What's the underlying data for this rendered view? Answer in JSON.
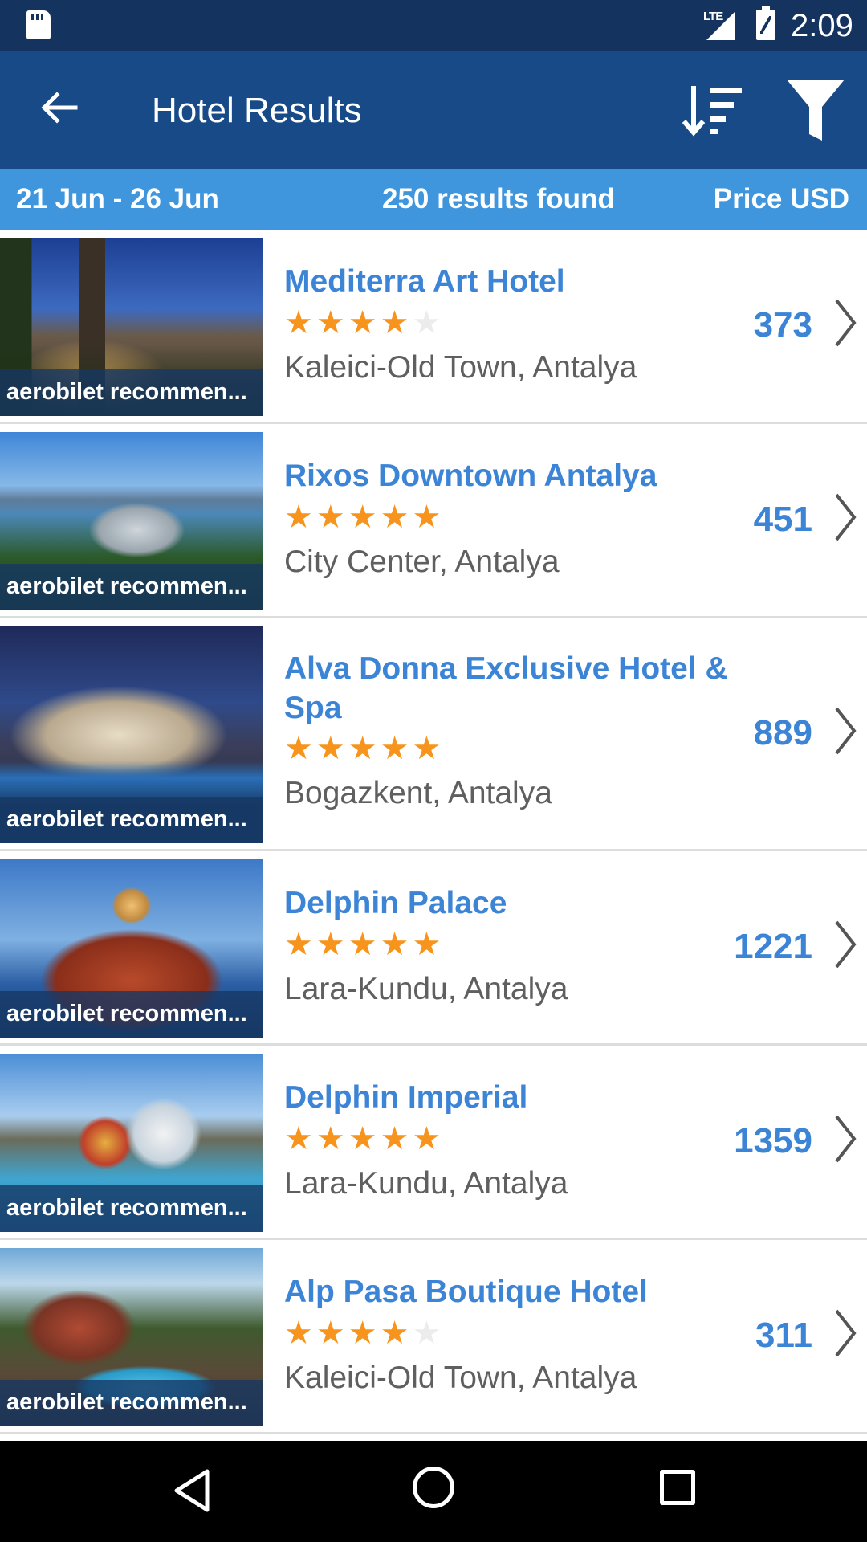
{
  "status_bar": {
    "network_label": "LTE",
    "time": "2:09",
    "icons": [
      "sd-card-icon",
      "signal-icon",
      "battery-icon"
    ]
  },
  "app_bar": {
    "title": "Hotel Results",
    "icons": [
      "back-arrow-icon",
      "sort-icon",
      "filter-icon"
    ],
    "background": "#174a87"
  },
  "summary": {
    "dates": "21 Jun - 26 Jun",
    "results": "250 results found",
    "currency": "Price USD",
    "background": "#3f96dd"
  },
  "colors": {
    "accent": "#3c84d6",
    "star": "#f7941d",
    "location_text": "#5f5f5f"
  },
  "hotels": [
    {
      "name": "Mediterra Art Hotel",
      "stars": 4,
      "location": "Kaleici-Old Town, Antalya",
      "price": "373",
      "badge": "aerobilet recommen..."
    },
    {
      "name": "Rixos Downtown Antalya",
      "stars": 5,
      "location": "City Center, Antalya",
      "price": "451",
      "badge": "aerobilet recommen..."
    },
    {
      "name": "Alva Donna Exclusive Hotel & Spa",
      "stars": 5,
      "location": "Bogazkent, Antalya",
      "price": "889",
      "badge": "aerobilet recommen..."
    },
    {
      "name": "Delphin Palace",
      "stars": 5,
      "location": "Lara-Kundu, Antalya",
      "price": "1221",
      "badge": "aerobilet recommen..."
    },
    {
      "name": "Delphin Imperial",
      "stars": 5,
      "location": "Lara-Kundu, Antalya",
      "price": "1359",
      "badge": "aerobilet recommen..."
    },
    {
      "name": "Alp Pasa Boutique Hotel",
      "stars": 4,
      "location": "Kaleici-Old Town, Antalya",
      "price": "311",
      "badge": "aerobilet recommen..."
    }
  ],
  "nav_bar": {
    "icons": [
      "nav-back-icon",
      "nav-home-icon",
      "nav-recent-apps-icon"
    ]
  }
}
